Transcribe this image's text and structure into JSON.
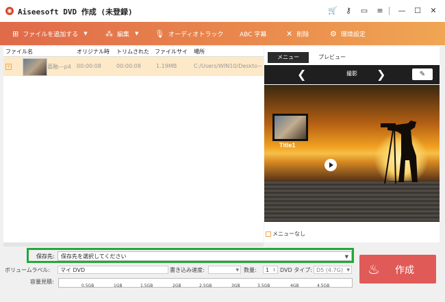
{
  "window": {
    "app_title": "Aiseesoft DVD 作成 (未登録)",
    "icons": [
      "cart-icon",
      "key-icon",
      "feedback-icon",
      "menu-icon",
      "minimize-icon",
      "maximize-icon",
      "close-icon"
    ]
  },
  "toolbar": {
    "add_file": "ファイルを追加する",
    "edit": "編集",
    "audio_track": "オーディオトラック",
    "subtitle": "ABC 字幕",
    "delete": "削除",
    "settings": "環境設定"
  },
  "file_list": {
    "columns": [
      "ファイル名",
      "オリジナル時",
      "トリムされた",
      "ファイルサイ",
      "場所"
    ],
    "rows": [
      {
        "name": "喜融---p4",
        "original_duration": "00:00:08",
        "trimmed_duration": "00:00:08",
        "size": "1.19MB",
        "location": "C:/Users/WIN10/Deskto~"
      }
    ]
  },
  "preview": {
    "tab_menu": "メニュー",
    "tab_preview": "プレビュー",
    "menu_title": "撮影",
    "chapter_label": "Title1",
    "no_menu": "メニューなし"
  },
  "destination": {
    "label": "保存先:",
    "value": "保存先を選択してください"
  },
  "volume": {
    "label": "ボリュームラベル:",
    "value": "マイ DVD",
    "write_speed_label": "書き込み速度:",
    "write_speed_value": "",
    "count_label": "数量:",
    "count_value": "1",
    "type_label": "DVD タイプ:",
    "type_value": "D5 (4.7G)"
  },
  "capacity": {
    "label": "容量見積:",
    "ticks": [
      "0.5GB",
      "1GB",
      "1.5GB",
      "2GB",
      "2.5GB",
      "3GB",
      "3.5GB",
      "4GB",
      "4.5GB"
    ]
  },
  "create_button": "作成",
  "colors": {
    "toolbar_start": "#e06a4a",
    "toolbar_end": "#f0a653",
    "selected_row": "#fde9c8",
    "highlight_border": "#22a83a",
    "create_button": "#e05a57"
  }
}
